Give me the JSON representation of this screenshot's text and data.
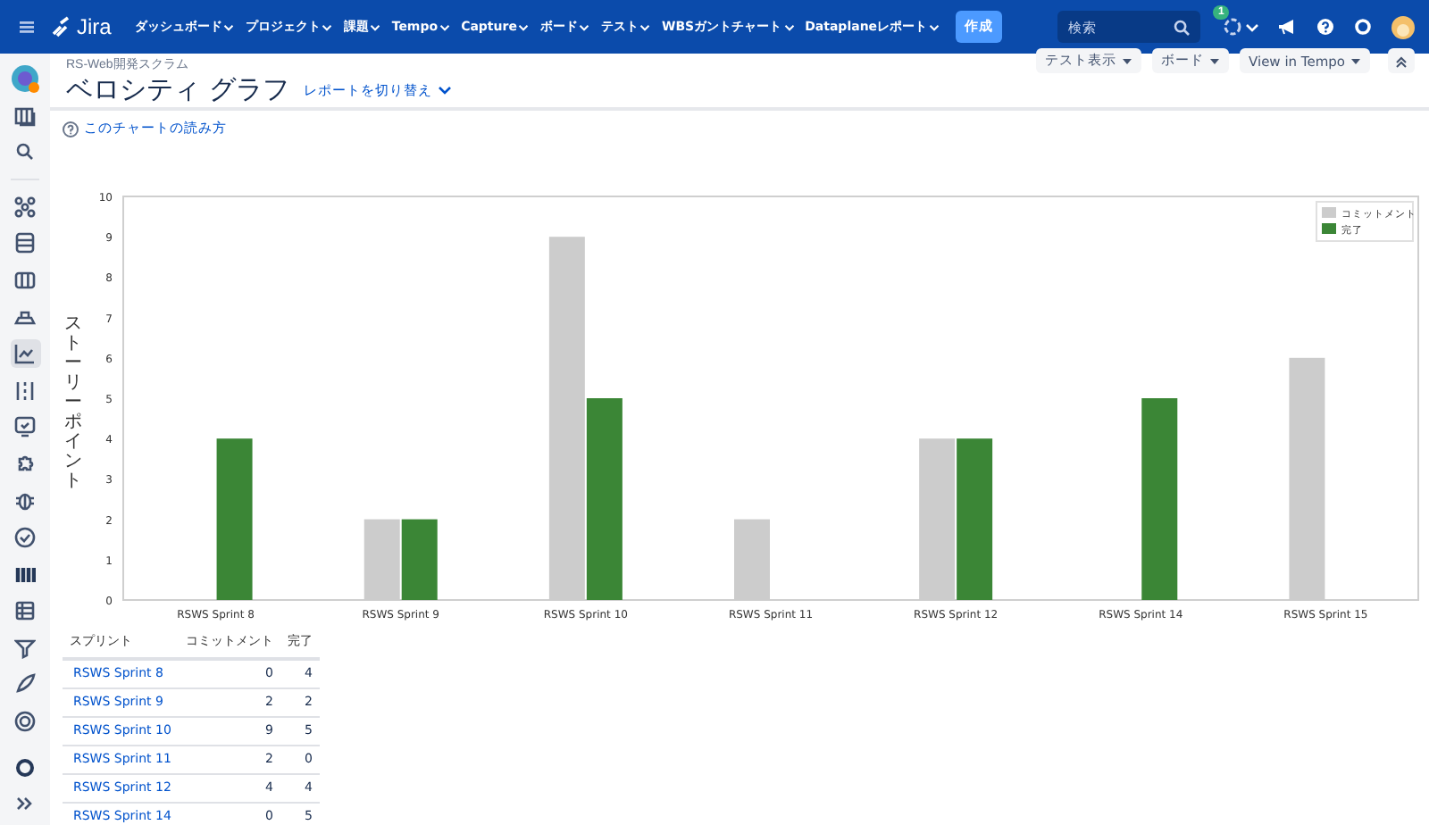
{
  "top_nav": {
    "product": "Jira",
    "menus": [
      {
        "label": "ダッシュボード"
      },
      {
        "label": "プロジェクト"
      },
      {
        "label": "課題"
      },
      {
        "label": "Tempo"
      },
      {
        "label": "Capture"
      },
      {
        "label": "ボード"
      },
      {
        "label": "テスト"
      },
      {
        "label": "WBSガントチャート"
      },
      {
        "label": "Dataplaneレポート"
      }
    ],
    "create_button": "作成",
    "search": {
      "placeholder": "検索"
    },
    "notification_count": "1"
  },
  "sidebar": {
    "items": [
      {
        "selected": false
      },
      {
        "selected": false
      },
      {
        "selected": false
      },
      {
        "selected": false
      },
      {
        "selected": false
      },
      {
        "selected": false
      },
      {
        "selected": false
      },
      {
        "selected": true
      },
      {
        "selected": false
      },
      {
        "selected": false
      },
      {
        "selected": false
      },
      {
        "selected": false
      },
      {
        "selected": false
      },
      {
        "selected": false
      },
      {
        "selected": false
      }
    ]
  },
  "header": {
    "breadcrumb": "RS-Web開発スクラム",
    "title": "ベロシティ グラフ",
    "switch_report": "レポートを切り替え",
    "buttons": [
      {
        "label": "テスト表示"
      },
      {
        "label": "ボード"
      },
      {
        "label": "View in Tempo"
      }
    ]
  },
  "help_link": "このチャートの読み方",
  "chart": {
    "chart_data": {
      "type": "bar",
      "legend": true,
      "ylabel": "ストーリーポイント",
      "categories": [
        "RSWS Sprint 8",
        "RSWS Sprint 9",
        "RSWS Sprint 10",
        "RSWS Sprint 11",
        "RSWS Sprint 12",
        "RSWS Sprint 14",
        "RSWS Sprint 15"
      ],
      "ylim": [
        0,
        10
      ],
      "yticks": [
        0,
        1,
        2,
        3,
        4,
        5,
        6,
        7,
        8,
        9,
        10
      ],
      "series": [
        {
          "name": "コミットメント",
          "color": "#cccccc",
          "values": [
            0,
            2,
            9,
            2,
            4,
            0,
            6
          ]
        },
        {
          "name": "完了",
          "color": "#3b8636",
          "values": [
            4,
            2,
            5,
            0,
            4,
            5,
            0
          ]
        }
      ]
    }
  },
  "table": {
    "columns": [
      "スプリント",
      "コミットメント",
      "完了"
    ],
    "rows": [
      {
        "sprint": "RSWS Sprint 8",
        "commitment": "0",
        "completed": "4"
      },
      {
        "sprint": "RSWS Sprint 9",
        "commitment": "2",
        "completed": "2"
      },
      {
        "sprint": "RSWS Sprint 10",
        "commitment": "9",
        "completed": "5"
      },
      {
        "sprint": "RSWS Sprint 11",
        "commitment": "2",
        "completed": "0"
      },
      {
        "sprint": "RSWS Sprint 12",
        "commitment": "4",
        "completed": "4"
      },
      {
        "sprint": "RSWS Sprint 14",
        "commitment": "0",
        "completed": "5"
      }
    ]
  }
}
